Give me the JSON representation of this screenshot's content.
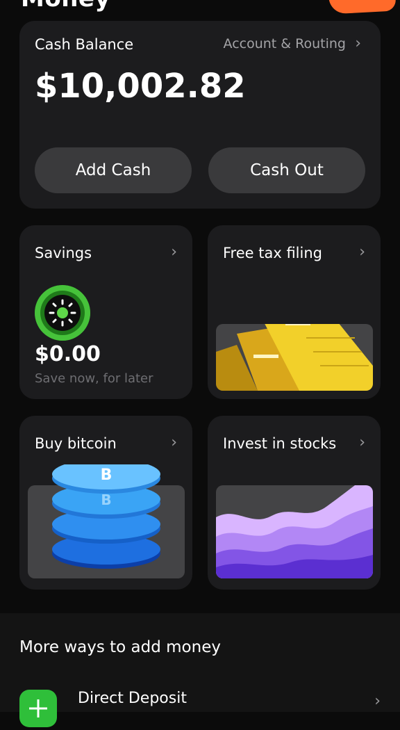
{
  "header": {
    "title": "Money"
  },
  "balance": {
    "label": "Cash Balance",
    "account_link": "Account & Routing",
    "amount": "$10,002.82",
    "add_cash": "Add Cash",
    "cash_out": "Cash Out"
  },
  "tiles": {
    "savings": {
      "title": "Savings",
      "amount": "$0.00",
      "subtitle": "Save now, for later"
    },
    "tax": {
      "title": "Free tax filing"
    },
    "bitcoin": {
      "title": "Buy bitcoin"
    },
    "stocks": {
      "title": "Invest in stocks"
    }
  },
  "more": {
    "title": "More ways to add money",
    "direct_deposit": "Direct Deposit"
  },
  "colors": {
    "card": "#1c1c1e",
    "pill": "#3a3a3c",
    "accent_green": "#2fbf3a",
    "bitcoin_blue": "#2c8be6",
    "stocks_purple": "#9d7bf0",
    "tax_yellow": "#f2d02a"
  },
  "icons": [
    "chevron-right-icon",
    "savings-sun-icon",
    "plus-icon"
  ]
}
